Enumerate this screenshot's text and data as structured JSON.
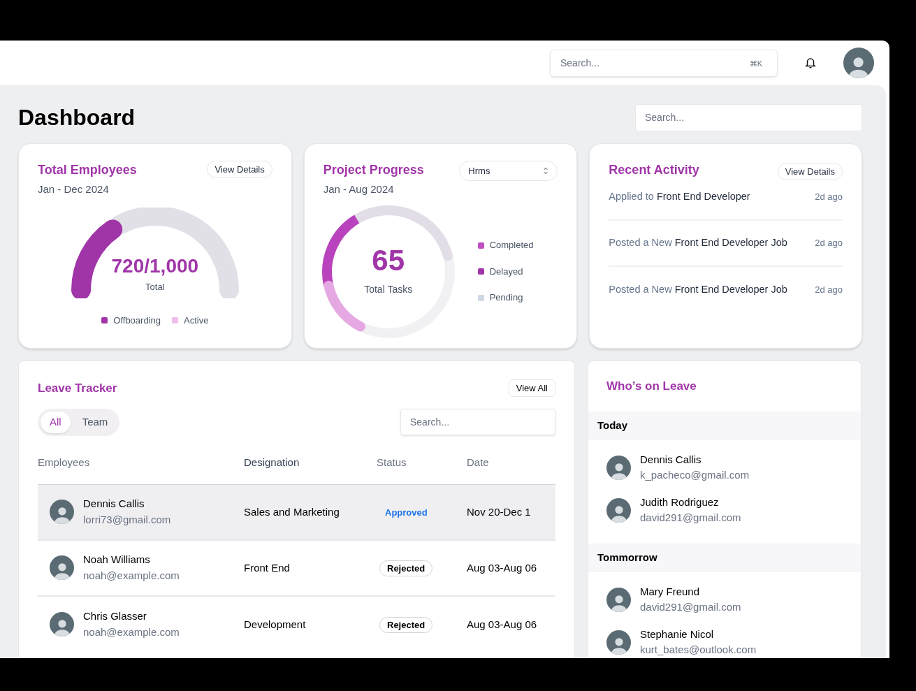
{
  "header": {
    "search": {
      "placeholder": "Search...",
      "shortcut": "⌘K"
    }
  },
  "page": {
    "title": "Dashboard",
    "search": {
      "placeholder": "Search..."
    }
  },
  "total_employees": {
    "title": "Total Employees",
    "period": "Jan - Dec 2024",
    "button": "View Details",
    "value": "720/1,000",
    "caption": "Total",
    "legend": [
      {
        "label": "Offboarding",
        "color": "#a035a8"
      },
      {
        "label": "Active",
        "color": "#efbdea"
      }
    ]
  },
  "project_progress": {
    "title": "Project Progress",
    "period": "Jan - Aug 2024",
    "select": "Hrms",
    "value": "65",
    "caption": "Total Tasks",
    "legend": [
      {
        "label": "Completed",
        "color": "#c04fc0"
      },
      {
        "label": "Delayed",
        "color": "#a035a8"
      },
      {
        "label": "Pending",
        "color": "#cfd8e3"
      }
    ]
  },
  "recent_activity": {
    "title": "Recent Activity",
    "button": "View Details",
    "items": [
      {
        "text": "Applied to **Front End Developer**",
        "time": "2d ago"
      },
      {
        "text": "Posted a New **Front End Developer Job**",
        "time": "2d ago"
      },
      {
        "text": "Posted a New **Front End Developer Job**",
        "time": "2d ago"
      }
    ]
  },
  "leave_tracker": {
    "title": "Leave Tracker",
    "button": "View All",
    "tabs": [
      {
        "label": "All",
        "selected": true
      },
      {
        "label": "Team",
        "selected": false
      }
    ],
    "search": {
      "placeholder": "Search..."
    },
    "columns": [
      "Employees",
      "Designation",
      "Status",
      "Date"
    ],
    "rows": [
      {
        "name": "Dennis Callis",
        "email": "lorri73@gmail.com",
        "designation": "Sales and Marketing",
        "status": "Approved",
        "kind": "approved",
        "date": "Nov 20-Dec 1",
        "selected": true
      },
      {
        "name": "Noah Williams",
        "email": "noah@example.com",
        "designation": "Front End",
        "status": "Rejected",
        "kind": "rejected",
        "date": "Aug 03-Aug 06",
        "selected": false
      },
      {
        "name": "Chris Glasser",
        "email": "noah@example.com",
        "designation": "Development",
        "status": "Rejected",
        "kind": "rejected",
        "date": "Aug 03-Aug 06",
        "selected": false
      }
    ]
  },
  "whos_on_leave": {
    "title": "Who’s on Leave",
    "groups": [
      {
        "label": "Today",
        "people": [
          {
            "name": "Dennis Callis",
            "email": "k_pacheco@gmail.com"
          },
          {
            "name": "Judith Rodriguez",
            "email": "david291@gmail.com"
          }
        ]
      },
      {
        "label": "Tommorrow",
        "people": [
          {
            "name": "Mary Freund",
            "email": "david291@gmail.com"
          },
          {
            "name": "Stephanie Nicol",
            "email": "kurt_bates@outlook.com"
          }
        ]
      }
    ]
  }
}
